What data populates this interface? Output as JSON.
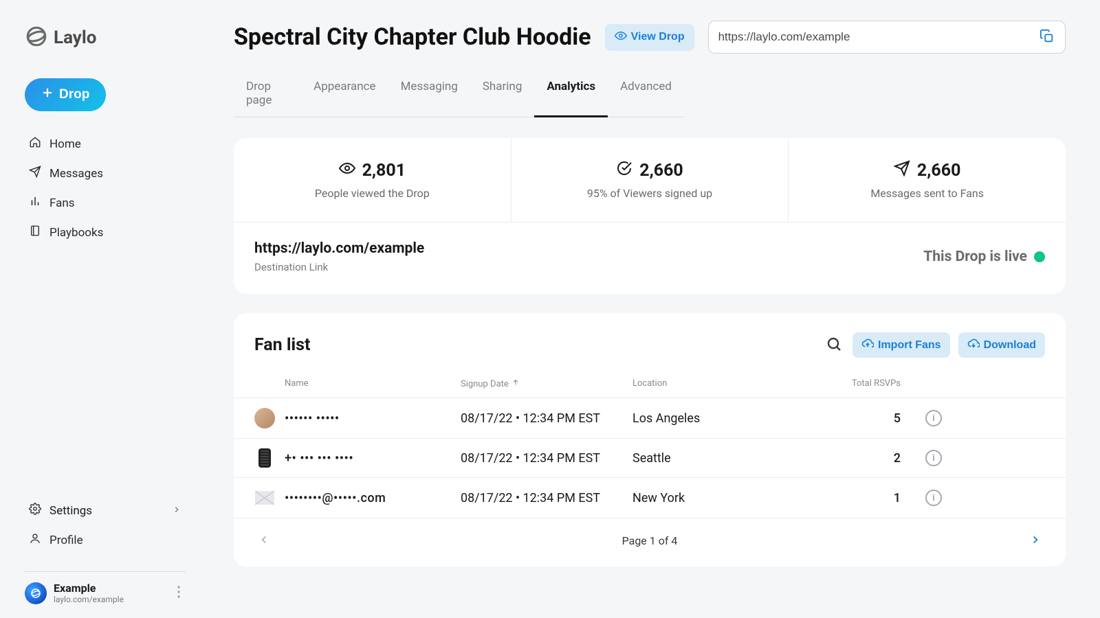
{
  "brand": {
    "name": "Laylo"
  },
  "sidebar": {
    "cta_label": "Drop",
    "nav": [
      {
        "label": "Home"
      },
      {
        "label": "Messages"
      },
      {
        "label": "Fans"
      },
      {
        "label": "Playbooks"
      }
    ],
    "lower": {
      "settings": "Settings",
      "profile": "Profile"
    },
    "workspace": {
      "name": "Example",
      "url": "laylo.com/example"
    }
  },
  "header": {
    "title": "Spectral City Chapter Club Hoodie",
    "view_drop": "View Drop",
    "url_value": "https://laylo.com/example"
  },
  "tabs": [
    {
      "label": "Drop page",
      "active": false
    },
    {
      "label": "Appearance",
      "active": false
    },
    {
      "label": "Messaging",
      "active": false
    },
    {
      "label": "Sharing",
      "active": false
    },
    {
      "label": "Analytics",
      "active": true
    },
    {
      "label": "Advanced",
      "active": false
    }
  ],
  "stats": [
    {
      "value": "2,801",
      "label": "People viewed the Drop",
      "icon": "eye"
    },
    {
      "value": "2,660",
      "label": "95% of Viewers signed up",
      "icon": "check-circle"
    },
    {
      "value": "2,660",
      "label": "Messages sent to Fans",
      "icon": "send"
    }
  ],
  "destination": {
    "url": "https://laylo.com/example",
    "label": "Destination Link",
    "status_text": "This Drop is live"
  },
  "fanlist": {
    "title": "Fan list",
    "import_label": "Import Fans",
    "download_label": "Download",
    "columns": {
      "name": "Name",
      "signup": "Signup Date",
      "location": "Location",
      "rsvps": "Total RSVPs"
    },
    "rows": [
      {
        "avatar": "person",
        "name": "•••••• •••••",
        "signup": "08/17/22 • 12:34 PM EST",
        "location": "Los Angeles",
        "rsvps": "5"
      },
      {
        "avatar": "phone",
        "name": "+• ••• ••• ••••",
        "signup": "08/17/22 • 12:34 PM EST",
        "location": "Seattle",
        "rsvps": "2"
      },
      {
        "avatar": "mail",
        "name": "••••••••@•••••.com",
        "signup": "08/17/22 • 12:34 PM EST",
        "location": "New York",
        "rsvps": "1"
      }
    ],
    "pager_text": "Page 1 of 4"
  }
}
